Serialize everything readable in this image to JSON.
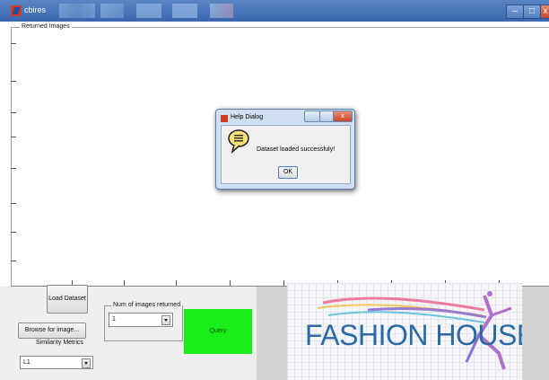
{
  "window": {
    "title": "cbires",
    "min_glyph": "–",
    "max_glyph": "□",
    "close_glyph": "x"
  },
  "panel": {
    "label": "Returned Images"
  },
  "controls": {
    "load_dataset_label": "Load Dataset",
    "browse_label": "Browse for image...",
    "similarity_label": "Similarity Metrics",
    "similarity_value": "L1",
    "num_images_group_label": "Num of images returned",
    "num_images_value": "1",
    "query_label": "Query"
  },
  "logo": {
    "text": "FASHION HOUSE"
  },
  "dialog": {
    "title": "Help Dialog",
    "message": "Dataset loaded successfuly!",
    "ok_label": "OK",
    "close_glyph": "x"
  },
  "colors": {
    "titlebar": "#3a66ae",
    "query_button": "#1aee1a",
    "logo_text": "#2b6aa4"
  }
}
